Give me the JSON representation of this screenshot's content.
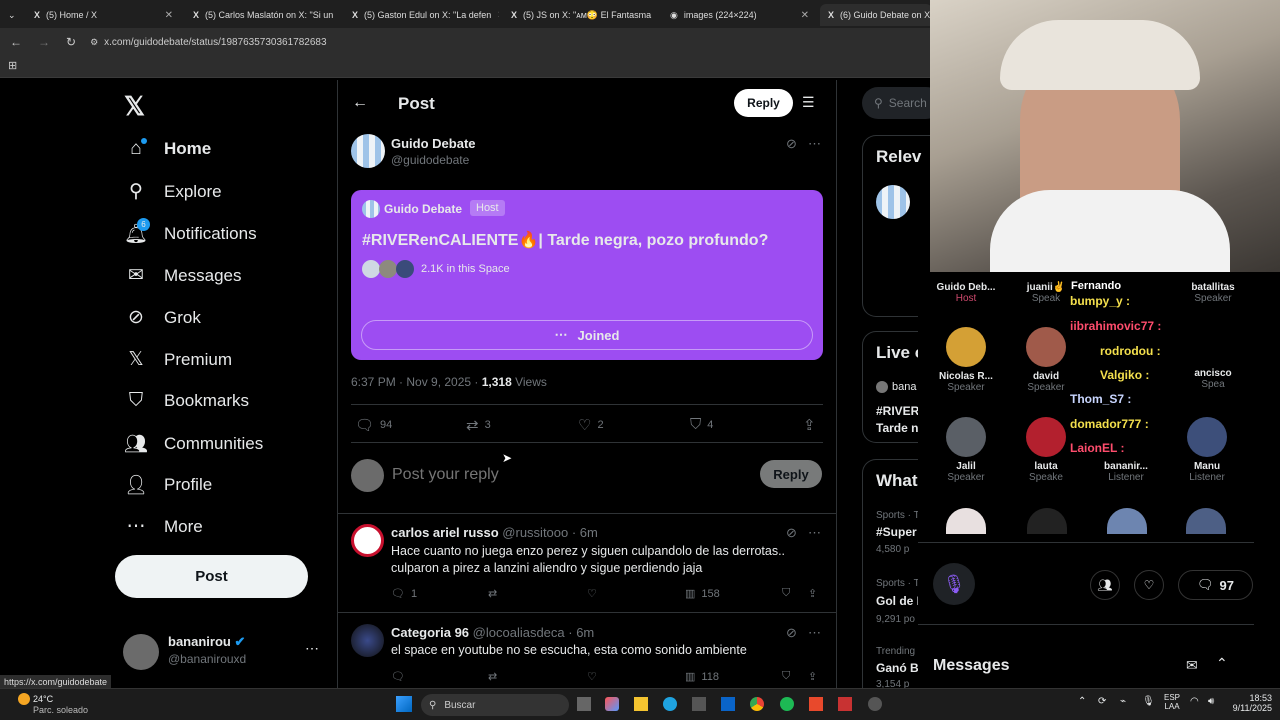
{
  "browser": {
    "tabs": [
      {
        "title": "(5) Home / X"
      },
      {
        "title": "(5) Carlos Maslatón on X: \"Si un"
      },
      {
        "title": "(5) Gaston Edul on X: \"La defen"
      },
      {
        "title": "(5) JS on X: \"ᴀᴍ😳 El Fantasma"
      },
      {
        "title": "images (224×224)"
      },
      {
        "title": "(6) Guido Debate on X: \"h"
      }
    ],
    "url": "x.com/guidodebate/status/1987635730361782683",
    "status_url": "https://x.com/guidodebate"
  },
  "nav": {
    "items": [
      {
        "label": "Home",
        "icon": "home-icon"
      },
      {
        "label": "Explore",
        "icon": "search-icon"
      },
      {
        "label": "Notifications",
        "icon": "bell-icon",
        "badge": "6"
      },
      {
        "label": "Messages",
        "icon": "envelope-icon"
      },
      {
        "label": "Grok",
        "icon": "grok-icon"
      },
      {
        "label": "Premium",
        "icon": "x-logo-icon"
      },
      {
        "label": "Bookmarks",
        "icon": "bookmark-icon"
      },
      {
        "label": "Communities",
        "icon": "people-icon"
      },
      {
        "label": "Profile",
        "icon": "person-icon"
      },
      {
        "label": "More",
        "icon": "more-circle-icon"
      }
    ],
    "post_button": "Post",
    "account": {
      "name": "bananirou",
      "handle": "@bananirouxd"
    }
  },
  "post": {
    "header_title": "Post",
    "reply_button": "Reply",
    "author_name": "Guido Debate",
    "author_handle": "@guidodebate",
    "space": {
      "host_name": "Guido Debate",
      "host_badge": "Host",
      "title": "#RIVERenCALIENTE🔥| Tarde negra, pozo profundo?",
      "listeners": "2.1K in this Space",
      "joined_label": "Joined"
    },
    "timestamp": "6:37 PM · Nov 9, 2025 · ",
    "views_count": "1,318",
    "views_label": " Views",
    "stats": {
      "replies": "94",
      "reposts": "3",
      "likes": "2",
      "bookmarks": "4"
    },
    "compose_placeholder": "Post your reply",
    "compose_button": "Reply"
  },
  "replies": [
    {
      "name": "carlos ariel russo",
      "handle": "@russitooo · 6m",
      "text": "Hace cuanto no juega enzo perez y siguen culpandolo de las derrotas.. culparon a pirez a lanzini aliendro y sigue perdiendo jaja",
      "replies": "1",
      "views": "158"
    },
    {
      "name": "Categoria 96",
      "handle": "@locoaliasdeca · 6m",
      "text": "el space en youtube no se escucha, esta como sonido ambiente",
      "views": "118"
    }
  ],
  "right": {
    "search_placeholder": "Search",
    "relevant_title": "Relev",
    "live_title": "Live o",
    "live_user": "bana",
    "live_text1": "#RIVER",
    "live_text2": "Tarde n",
    "whats_title": "What",
    "trends": [
      {
        "cat": "Sports · T",
        "name": "#Super",
        "count": "4,580 p"
      },
      {
        "cat": "Sports · T",
        "name": "Gol de E",
        "count": "9,291 po"
      },
      {
        "cat": "Trending",
        "name": "Ganó B",
        "count": "3,154 p"
      }
    ]
  },
  "space_panel": {
    "speakers": [
      {
        "name": "Guido Deb...",
        "role": "Host"
      },
      {
        "name": "juanii✌",
        "role": "Speak"
      },
      {
        "name": "batallitas",
        "role": "Speaker"
      },
      {
        "name": "Nicolas R...",
        "role": "Speaker"
      },
      {
        "name": "david",
        "role": "Speaker"
      },
      {
        "name": "ancisco",
        "role": "Spea"
      },
      {
        "name": "Jalil",
        "role": "Speaker"
      },
      {
        "name": "lauta",
        "role": "Speake"
      },
      {
        "name": "bananir...",
        "role": "Listener"
      },
      {
        "name": "Manu",
        "role": "Listener"
      }
    ],
    "chat": [
      {
        "name": "Fernando",
        "color": "#ffffff"
      },
      {
        "name": "bumpy_y :",
        "color": "#f4e04d"
      },
      {
        "name": "iibrahimovic77 :",
        "color": "#ff4d6d"
      },
      {
        "name": "rodrodou :",
        "color": "#f4e04d"
      },
      {
        "name": "Valgiko :",
        "color": "#f4e04d"
      },
      {
        "name": "Thom_S7 :",
        "color": "#c9d6ff"
      },
      {
        "name": "domador777 :",
        "color": "#f4e04d"
      },
      {
        "name": "LaionEL :",
        "color": "#ff4d6d"
      }
    ],
    "chat_count": "97",
    "messages_title": "Messages"
  },
  "taskbar": {
    "weather_temp": "24°C",
    "weather_desc": "Parc. soleado",
    "search": "Buscar",
    "lang1": "ESP",
    "lang2": "LAA",
    "time": "18:53",
    "date": "9/11/2025"
  },
  "colors": {
    "space_purple": "#9d4df2",
    "accent_blue": "#1d9bf0",
    "bg": "#000000"
  }
}
